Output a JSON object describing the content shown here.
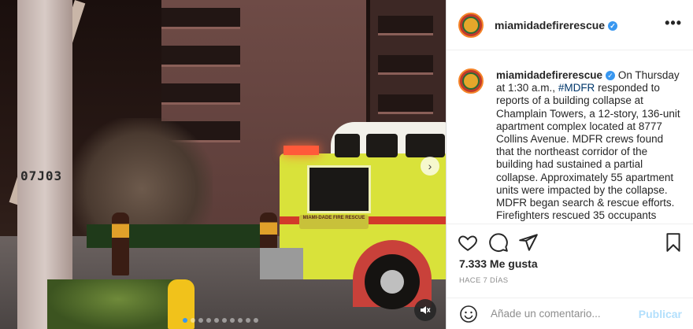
{
  "media": {
    "pole_text": "07J03",
    "truck_logo": "MIAMI-DADE FIRE RESCUE",
    "carousel_total": 10,
    "carousel_active": 1,
    "next_icon": "chevron-right-icon",
    "mute_icon": "speaker-muted-icon"
  },
  "header": {
    "username": "miamidadefirerescue",
    "verified_mark": "✓",
    "more": "•••"
  },
  "caption": {
    "username": "miamidadefirerescue",
    "verified_mark": "✓",
    "text_before_tag": "On Thursday at 1:30 a.m.,",
    "hashtag": "#MDFR",
    "text_after_tag": "responded to reports of a building collapse at Champlain Towers, a 12-story, 136-unit apartment complex located at 8777 Collins Avenue. MDFR crews found that the northeast corridor of the building had sustained a partial collapse. Approximately 55 apartment units were impacted by the collapse. MDFR began search & rescue efforts. Firefighters rescued 35 occupants"
  },
  "actions": {
    "like_icon": "heart-icon",
    "comment_icon": "comment-icon",
    "share_icon": "paper-plane-icon",
    "save_icon": "bookmark-icon"
  },
  "likes": "7.333 Me gusta",
  "time_ago": "HACE 7 DÍAS",
  "comment": {
    "placeholder": "Añade un comentario...",
    "post_label": "Publicar",
    "emoji_icon": "smiley-icon"
  },
  "colors": {
    "link": "#00376b",
    "verified": "#3897f0",
    "post_disabled": "#b2dffc",
    "muted_text": "#8e8e8e"
  }
}
